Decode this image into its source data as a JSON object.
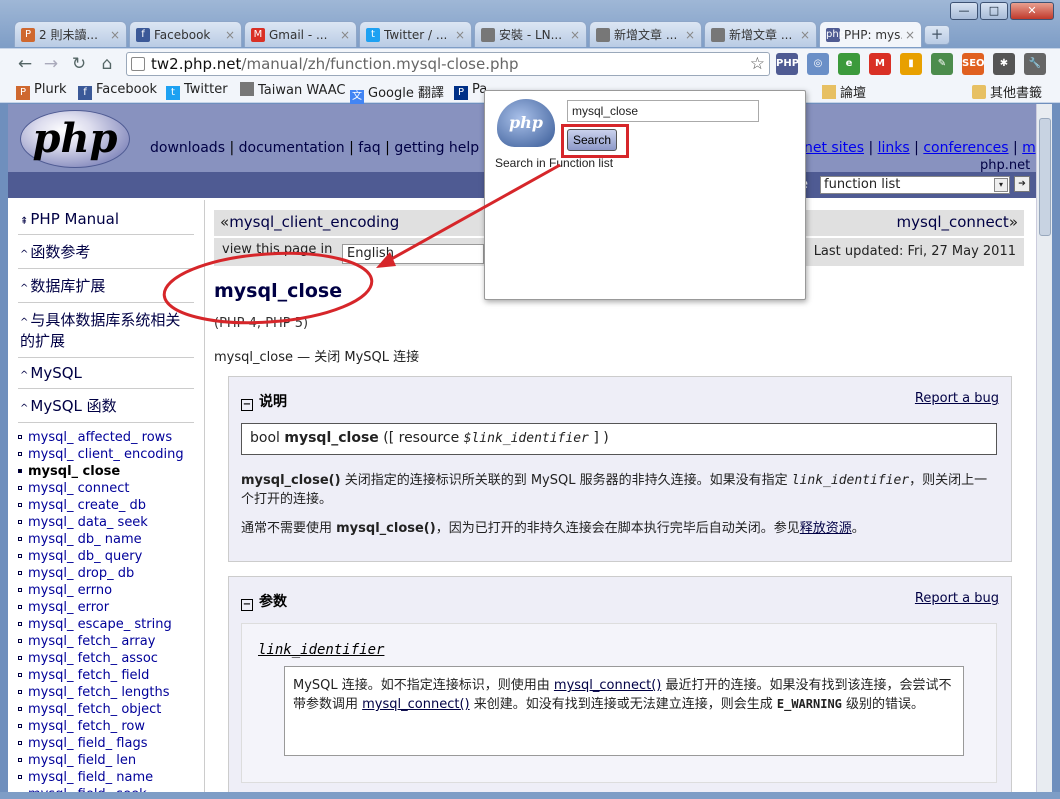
{
  "window_controls": {
    "minimize": "—",
    "maximize": "□",
    "close": "✕"
  },
  "tabs": [
    {
      "icon": "plurk-icon",
      "favicon_text": "P",
      "color": "#cf682f",
      "title": "2 則未讀..."
    },
    {
      "icon": "facebook-icon",
      "favicon_text": "f",
      "color": "#3b5998",
      "title": "Facebook"
    },
    {
      "icon": "gmail-icon",
      "favicon_text": "M",
      "color": "#d93025",
      "title": "Gmail - ..."
    },
    {
      "icon": "twitter-icon",
      "favicon_text": "t",
      "color": "#1da1f2",
      "title": "Twitter / ..."
    },
    {
      "icon": "page-icon",
      "favicon_text": "",
      "color": "#777777",
      "title": "安裝 - LN..."
    },
    {
      "icon": "page-icon",
      "favicon_text": "",
      "color": "#777777",
      "title": "新增文章 ..."
    },
    {
      "icon": "page-icon",
      "favicon_text": "",
      "color": "#777777",
      "title": "新增文章 ..."
    },
    {
      "icon": "php-icon",
      "favicon_text": "php",
      "color": "#4f5b93",
      "title": "PHP: mys..."
    }
  ],
  "tab_close": "×",
  "new_tab": "+",
  "url": {
    "host": "tw2.php.net",
    "path": "/manual/zh/function.mysql-close.php"
  },
  "extensions": [
    {
      "name": "php-extension-icon",
      "label": "PHP",
      "color": "#4f5b93"
    },
    {
      "name": "rss-icon",
      "label": "◎",
      "color": "#6a8fc7"
    },
    {
      "name": "evernote-icon",
      "label": "e",
      "color": "#3c9a3c"
    },
    {
      "name": "gmail-ext-icon",
      "label": "M",
      "color": "#d93025"
    },
    {
      "name": "stats-icon",
      "label": "▮",
      "color": "#e8a000"
    },
    {
      "name": "clip-icon",
      "label": "✎",
      "color": "#4c8c4c"
    },
    {
      "name": "seo-icon",
      "label": "SEO",
      "color": "#e06020"
    },
    {
      "name": "bug-icon",
      "label": "✱",
      "color": "#555555"
    },
    {
      "name": "wrench-icon",
      "label": "🔧",
      "color": "#666666"
    }
  ],
  "bookmarks": [
    {
      "icon": "plurk-icon",
      "favicon_text": "P",
      "color": "#cf682f",
      "label": "Plurk"
    },
    {
      "icon": "facebook-icon",
      "favicon_text": "f",
      "color": "#3b5998",
      "label": "Facebook"
    },
    {
      "icon": "twitter-icon",
      "favicon_text": "t",
      "color": "#1da1f2",
      "label": "Twitter"
    },
    {
      "icon": "page-icon",
      "favicon_text": "",
      "color": "#777777",
      "label": "Taiwan WAAC"
    },
    {
      "icon": "translate-icon",
      "favicon_text": "文",
      "color": "#4285f4",
      "label": "Google 翻譯"
    },
    {
      "icon": "paypal-icon",
      "favicon_text": "P",
      "color": "#003087",
      "label": "Pa"
    },
    {
      "icon": "folder-icon",
      "favicon_text": "",
      "color": "#e7c063",
      "label": "論壇"
    }
  ],
  "other_bookmarks": "其他書籤",
  "php_nav": {
    "items": [
      "downloads",
      "documentation",
      "faq",
      "getting help",
      "m"
    ],
    "right_items": [
      "net sites",
      "links",
      "conferences",
      "my"
    ],
    "last": "php.net"
  },
  "search": {
    "label": "e",
    "selected": "function list",
    "dropdown": "▾",
    "go": "➔"
  },
  "sidebar": {
    "items": [
      {
        "arrow": "⇞",
        "label": "PHP Manual"
      },
      {
        "arrow": "^",
        "label": "函数参考"
      },
      {
        "arrow": "^",
        "label": "数据库扩展"
      },
      {
        "arrow": "^",
        "label": "与具体数据库系统相关的扩展"
      },
      {
        "arrow": "^",
        "label": "MySQL"
      },
      {
        "arrow": "^",
        "label": "MySQL 函数"
      }
    ],
    "functions": [
      "mysql_ affected_ rows",
      "mysql_ client_ encoding",
      "mysql_ close",
      "mysql_ connect",
      "mysql_ create_ db",
      "mysql_ data_ seek",
      "mysql_ db_ name",
      "mysql_ db_ query",
      "mysql_ drop_ db",
      "mysql_ errno",
      "mysql_ error",
      "mysql_ escape_ string",
      "mysql_ fetch_ array",
      "mysql_ fetch_ assoc",
      "mysql_ fetch_ field",
      "mysql_ fetch_ lengths",
      "mysql_ fetch_ object",
      "mysql_ fetch_ row",
      "mysql_ field_ flags",
      "mysql_ field_ len",
      "mysql_ field_ name",
      "mysql_ field_ seek"
    ],
    "current_index": 2
  },
  "prevnext": {
    "prev": "mysql_client_encoding",
    "next": "mysql_connect",
    "prev_arrow": "«",
    "next_arrow": "»"
  },
  "langbar": {
    "label": "view this page in",
    "language": "English",
    "last_updated": "Last updated: Fri, 27 May 2011"
  },
  "function": {
    "title": "mysql_close",
    "versions": "(PHP 4, PHP 5)",
    "refpurpose": "mysql_close — 关闭 MySQL 连接"
  },
  "description": {
    "heading": "说明",
    "report": "Report a bug",
    "synopsis": {
      "type": "bool",
      "name": "mysql_close",
      "open": "([ resource",
      "param": "$link_identifier",
      "close": "] )"
    },
    "para1_fn": "mysql_close()",
    "para1_a": " 关闭指定的连接标识所关联的到 MySQL 服务器的非持久连接。如果没有指定 ",
    "para1_var": "link_identifier",
    "para1_b": "，则关闭上一个打开的连接。",
    "para2_a": "通常不需要使用 ",
    "para2_fn": "mysql_close()",
    "para2_b": "，因为已打开的非持久连接会在脚本执行完毕后自动关闭。参见",
    "para2_link": "释放资源",
    "para2_c": "。"
  },
  "parameters": {
    "heading": "参数",
    "report": "Report a bug",
    "param_name": "link_identifier",
    "text_a": "MySQL 连接。如不指定连接标识，则使用由 ",
    "link1": "mysql_connect()",
    "text_b": " 最近打开的连接。如果没有找到该连接，会尝试不带参数调用 ",
    "link2": "mysql_connect()",
    "text_c": " 来创建。如没有找到连接或无法建立连接，则会生成 ",
    "mono": "E_WARNING",
    "text_d": " 级别的错误。"
  },
  "popup": {
    "logo": "php",
    "input_value": "mysql_close",
    "button": "Search",
    "hint": "Search in Function list"
  },
  "colors": {
    "annotation": "#d6262a",
    "php_purple": "#8892bf",
    "php_dark": "#4f5b93"
  }
}
